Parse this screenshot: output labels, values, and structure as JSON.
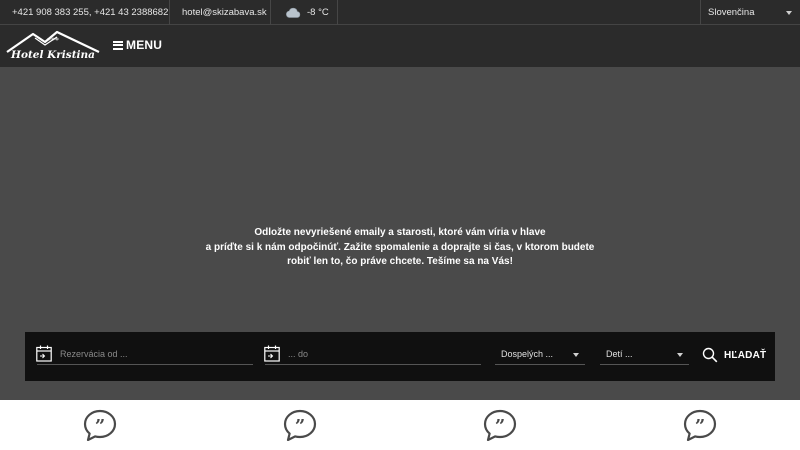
{
  "topbar": {
    "phones": "+421 908 383 255, +421 43 2388682",
    "email": "hotel@skizabava.sk",
    "temperature": "-8 °C",
    "language": "Slovenčina",
    "weather_icon": "cloud-icon"
  },
  "navbar": {
    "logo_text": "Hotel Kristina",
    "logo_stars": "***",
    "menu_label": "MENU"
  },
  "hero": {
    "lines": [
      "Odložte nevyriešené emaily a starosti, ktoré vám víria v hlave",
      "a príďte si k nám odpočinúť. Zažite spomalenie a doprajte si čas, v ktorom budete",
      "robiť len to, čo práve chcete. Tešíme sa na Vás!"
    ]
  },
  "search": {
    "date_from_placeholder": "Rezervácia od ...",
    "date_to_placeholder": "... do",
    "adults_label": "Dospelých ...",
    "children_label": "Detí ...",
    "button_label": "HĽADAŤ"
  },
  "colors": {
    "bar_bg": "#2b2b2b",
    "hero_bg": "#4a4a4a",
    "search_bg": "#101010",
    "quote_icon": "#4a4a4a"
  },
  "testimonials": {
    "icons": [
      "quote-bubble-icon",
      "quote-bubble-icon",
      "quote-bubble-icon",
      "quote-bubble-icon"
    ]
  }
}
